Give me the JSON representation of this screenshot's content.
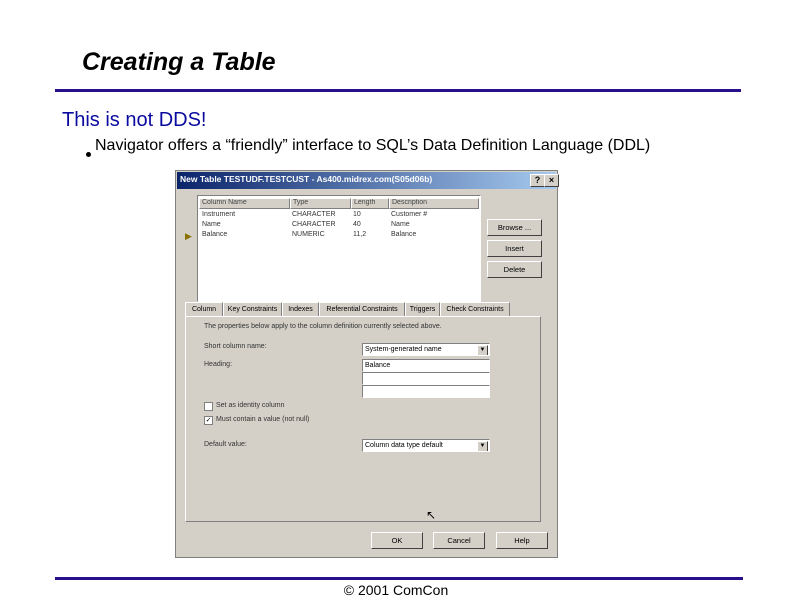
{
  "slide": {
    "title": "Creating a Table",
    "heading": "This is not DDS!",
    "bullet": "Navigator offers a “friendly” interface to SQL’s Data Definition Language (DDL)",
    "footer": "© 2001 ComCon"
  },
  "dialog": {
    "title": "New Table TESTUDF.TESTCUST - As400.midrex.com(S05d06b)",
    "help_button": "?",
    "close_button": "×",
    "columns_header": [
      "Column Name",
      "Type",
      "Length",
      "Description"
    ],
    "rows": [
      {
        "name": "Instrument",
        "type": "CHARACTER",
        "length": "10",
        "description": "Customer #"
      },
      {
        "name": "Name",
        "type": "CHARACTER",
        "length": "40",
        "description": "Name"
      },
      {
        "name": "Balance",
        "type": "NUMERIC",
        "length": "11,2",
        "description": "Balance"
      }
    ],
    "side_buttons": {
      "browse": "Browse ...",
      "insert": "Insert",
      "delete": "Delete"
    },
    "tabs": [
      "Column",
      "Key Constraints",
      "Indexes",
      "Referential Constraints",
      "Triggers",
      "Check Constraints"
    ],
    "panel": {
      "info_text": "The properties below apply to the column definition currently selected above.",
      "short_name_label": "Short column name:",
      "short_name_value": "System-generated name",
      "heading_label": "Heading:",
      "heading_value": "Balance",
      "heading_value2": "",
      "identity_label": "Set as identity column",
      "identity_checked": false,
      "notnull_label": "Must contain a value (not null)",
      "notnull_checked": true,
      "default_label": "Default value:",
      "default_value": "Column data type default",
      "dropdown_glyph": "▼",
      "check_glyph": "✓"
    },
    "bottom_buttons": {
      "ok": "OK",
      "cancel": "Cancel",
      "help": "Help"
    },
    "row_pointer_glyph": "▶",
    "cursor_glyph": "↖"
  }
}
